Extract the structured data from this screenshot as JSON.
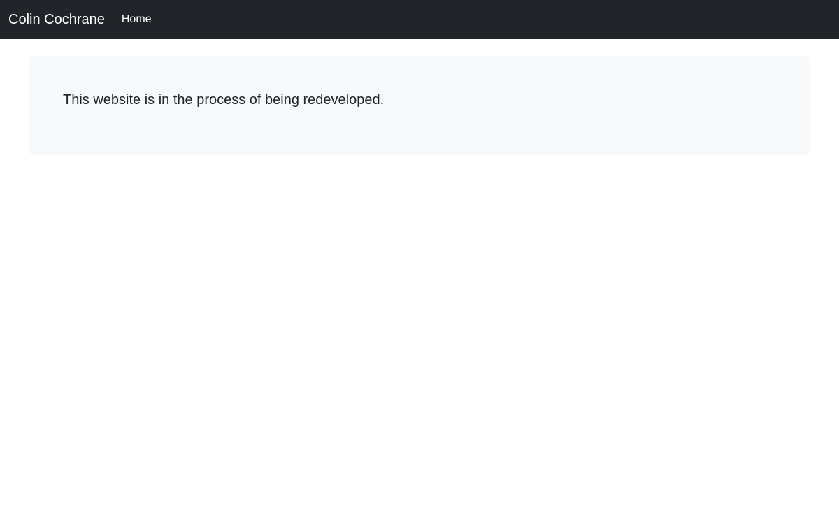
{
  "navbar": {
    "brand": "Colin Cochrane",
    "links": [
      {
        "label": "Home"
      }
    ]
  },
  "main": {
    "lead_text": "This website is in the process of being redeveloped."
  },
  "colors": {
    "navbar_bg": "#212529",
    "jumbotron_bg": "#f8f9fa",
    "text": "#212529",
    "nav_text": "#ffffff"
  }
}
